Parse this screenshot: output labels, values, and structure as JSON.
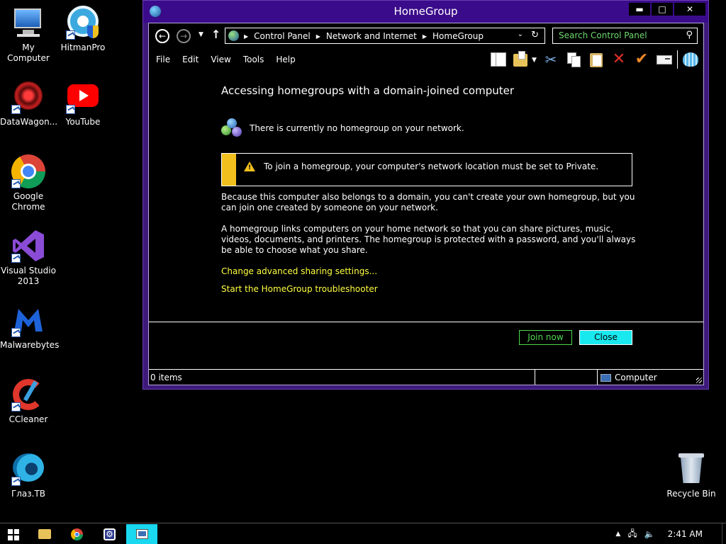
{
  "desktop": {
    "icons": [
      {
        "label": "My Computer"
      },
      {
        "label": "HitmanPro"
      },
      {
        "label": "DataWagon..."
      },
      {
        "label": "YouTube"
      },
      {
        "label": "Google Chrome"
      },
      {
        "label": "Visual Studio 2013"
      },
      {
        "label": "Malwarebytes"
      },
      {
        "label": "CCleaner"
      },
      {
        "label": "Глаз.ТВ"
      },
      {
        "label": "Recycle Bin"
      }
    ]
  },
  "window": {
    "title": "HomeGroup",
    "controls": {
      "minimize": "▬",
      "maximize": "□",
      "close": "✕"
    },
    "address": {
      "crumbs": [
        "Control Panel",
        "Network and Internet",
        "HomeGroup"
      ]
    },
    "search": {
      "placeholder": "Search Control Panel"
    },
    "menu": [
      "File",
      "Edit",
      "View",
      "Tools",
      "Help"
    ],
    "content": {
      "heading": "Accessing homegroups with a domain-joined computer",
      "status": "There is currently no homegroup on your network.",
      "warning": "To join a homegroup, your computer's network location must be set to Private.",
      "para1": "Because this computer also belongs to a domain, you can't create your own homegroup, but you can join one created by someone on your network.",
      "para2": "A homegroup links computers on your home network so that you can share pictures, music, videos, documents, and printers. The homegroup is protected with a password, and you'll always be able to choose what you share.",
      "link1": "Change advanced sharing settings...",
      "link2": "Start the HomeGroup troubleshooter"
    },
    "buttons": {
      "join": "Join now",
      "close": "Close"
    },
    "statusbar": {
      "items": "0 items",
      "location": "Computer"
    }
  },
  "taskbar": {
    "clock": "2:41 AM"
  },
  "colors": {
    "title_bar": "#3a0b8a",
    "link": "#ffff40",
    "join_button": "#4fd94f",
    "close_button": "#19e8ef",
    "warning_bar": "#f2c01e"
  }
}
